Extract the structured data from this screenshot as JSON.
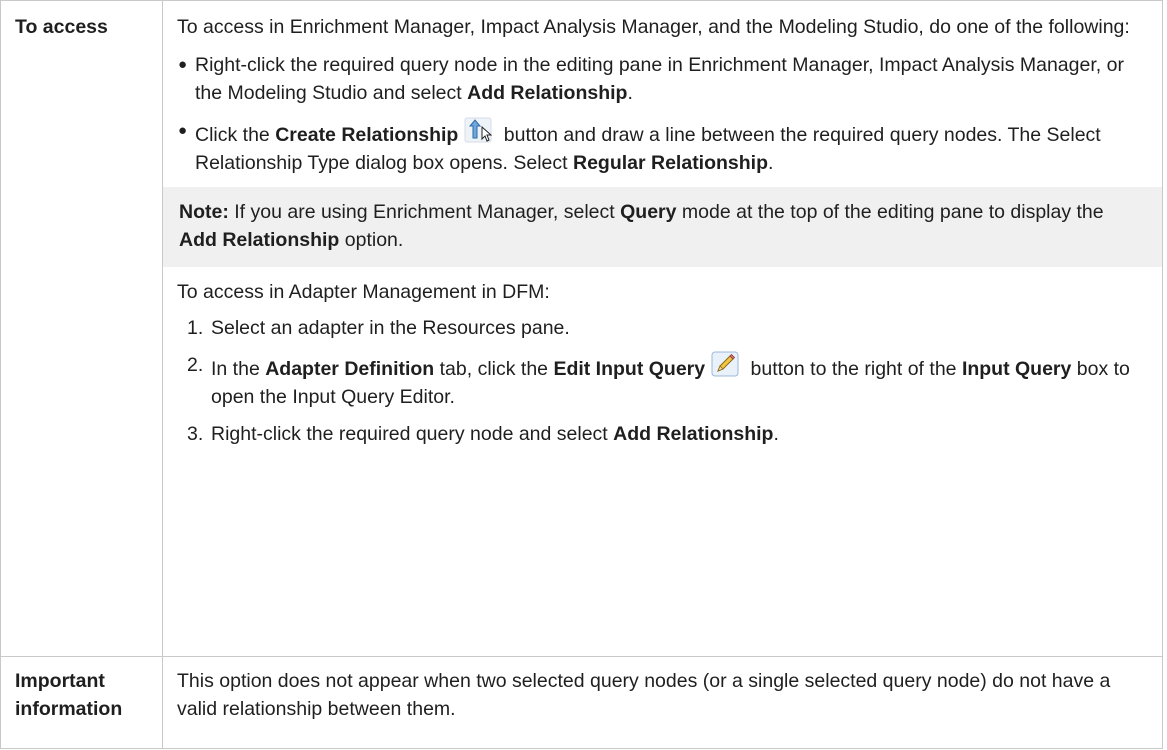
{
  "row1": {
    "label": "To access",
    "intro": "To access in Enrichment Manager, Impact Analysis Manager, and the Modeling Studio, do one of the following:",
    "bullet1": {
      "text": "Right-click the required query node in the editing pane in Enrichment Manager, Impact Analysis Manager, or the Modeling Studio and select ",
      "bold": "Add Relationship",
      "end": "."
    },
    "bullet2": {
      "pre": "Click the ",
      "bold1": "Create Relationship",
      "icon": "create-relationship-icon",
      "mid": " button and draw a line between the required query nodes. The Select Relationship Type dialog box opens. Select ",
      "bold2": "Regular Relationship",
      "end": "."
    },
    "note": {
      "label": "Note:",
      "t1": " If you are using Enrichment Manager, select ",
      "b1": "Query",
      "t2": " mode at the top of the editing pane to display the ",
      "b2": "Add Relationship",
      "t3": " option."
    },
    "dfm_intro": "To access in Adapter Management in DFM:",
    "steps": [
      {
        "num": "1.",
        "text": "Select an adapter in the Resources pane."
      },
      {
        "num": "2.",
        "t1": "In the ",
        "b1": "Adapter Definition",
        "t2": " tab, click the  ",
        "b2": "Edit Input Query",
        "icon": "pencil-edit-icon",
        "t3": " button to the right of the ",
        "b3": "Input Query",
        "t4": " box to open the Input Query Editor."
      },
      {
        "num": "3.",
        "t1": "Right-click the required query node and select ",
        "b1": "Add Relationship",
        "t2": "."
      }
    ]
  },
  "row2": {
    "label": "Important information",
    "text": "This option does not appear when two selected query nodes (or a single selected query node) do not have a valid relationship between them."
  },
  "colors": {
    "border": "#c9c9c9",
    "note_bg": "#f0f0f0",
    "text": "#1f1f1f"
  }
}
